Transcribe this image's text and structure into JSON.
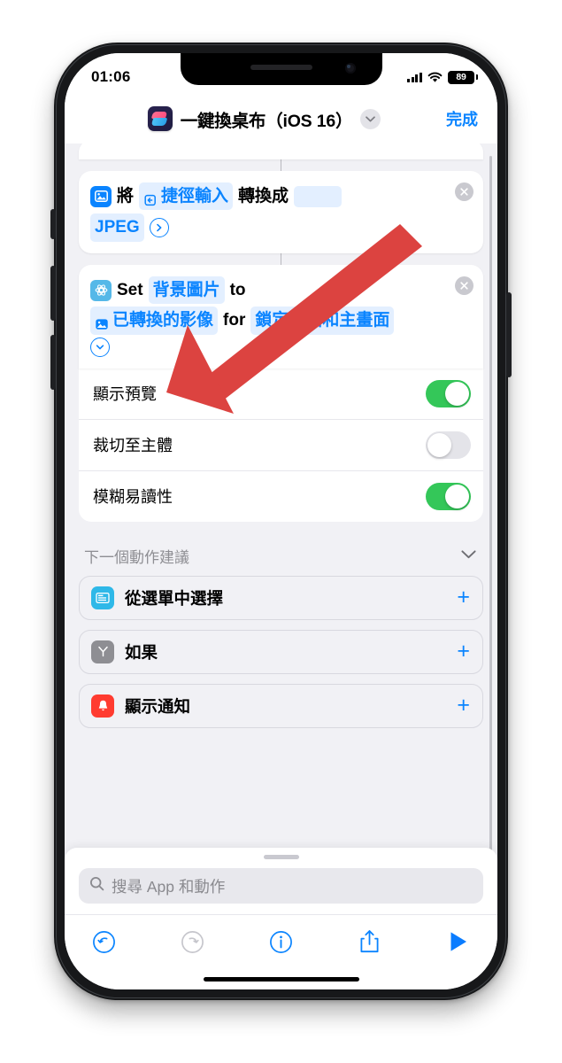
{
  "status_bar": {
    "time": "01:06",
    "battery_percent": "89",
    "signal_icon": "cellular-bars-icon",
    "wifi_icon": "wifi-icon",
    "battery_icon": "battery-icon"
  },
  "nav_bar": {
    "app_icon": "shortcuts-app-icon",
    "title": "一鍵換桌布（iOS 16）",
    "chevron_icon": "chevron-down-icon",
    "done_label": "完成"
  },
  "actions": [
    {
      "icon": "photo-convert-icon",
      "parts": [
        {
          "type": "icon",
          "name": "photo-icon"
        },
        {
          "type": "text",
          "value": "將"
        },
        {
          "type": "token_input",
          "value": "捷徑輸入",
          "icon": "shortcut-input-icon"
        },
        {
          "type": "text",
          "value": "轉換成"
        },
        {
          "type": "token_blank",
          "value": ""
        },
        {
          "type": "token",
          "value": "JPEG"
        },
        {
          "type": "disclosure",
          "name": "chevron-right-circle-icon"
        }
      ],
      "remove_icon": "remove-action-icon"
    },
    {
      "icon": "wallpaper-icon",
      "parts": [
        {
          "type": "icon",
          "name": "wallpaper-icon"
        },
        {
          "type": "text",
          "value": "Set"
        },
        {
          "type": "token",
          "value": "背景圖片"
        },
        {
          "type": "text",
          "value": "to"
        },
        {
          "type": "token_media",
          "value": "已轉換的影像",
          "icon": "photo-icon"
        },
        {
          "type": "text",
          "value": "for"
        },
        {
          "type": "token",
          "value": "鎖定畫面和主畫面"
        },
        {
          "type": "disclosure",
          "name": "chevron-down-circle-icon"
        }
      ],
      "remove_icon": "remove-action-icon"
    }
  ],
  "settings": [
    {
      "label": "顯示預覽",
      "state": "on"
    },
    {
      "label": "裁切至主體",
      "state": "off"
    },
    {
      "label": "模糊易讀性",
      "state": "on"
    }
  ],
  "suggestions": {
    "header": "下一個動作建議",
    "collapse_icon": "chevron-down-icon",
    "items": [
      {
        "label": "從選單中選擇",
        "icon": "menu-icon",
        "color": "#2eb8e8",
        "add_icon": "plus-icon"
      },
      {
        "label": "如果",
        "icon": "branch-icon",
        "color": "#8e8e93",
        "add_icon": "plus-icon"
      },
      {
        "label": "顯示通知",
        "icon": "bell-icon",
        "color": "#ff3b30",
        "add_icon": "plus-icon"
      }
    ]
  },
  "search": {
    "placeholder": "搜尋 App 和動作",
    "icon": "search-icon"
  },
  "toolbar": [
    {
      "name": "undo-button",
      "icon": "undo-icon",
      "enabled": true
    },
    {
      "name": "redo-button",
      "icon": "redo-icon",
      "enabled": false
    },
    {
      "name": "info-button",
      "icon": "info-circle-icon",
      "enabled": true
    },
    {
      "name": "share-button",
      "icon": "share-icon",
      "enabled": true
    },
    {
      "name": "run-button",
      "icon": "play-icon",
      "enabled": true
    }
  ],
  "annotation": {
    "arrow_color": "#dc4340",
    "arrow_target": "set-wallpaper-disclosure-chevron"
  },
  "colors": {
    "accent_blue": "#0a84ff",
    "toggle_on": "#34c759",
    "toggle_off": "#e4e4e9",
    "screen_bg": "#f1f1f5"
  }
}
